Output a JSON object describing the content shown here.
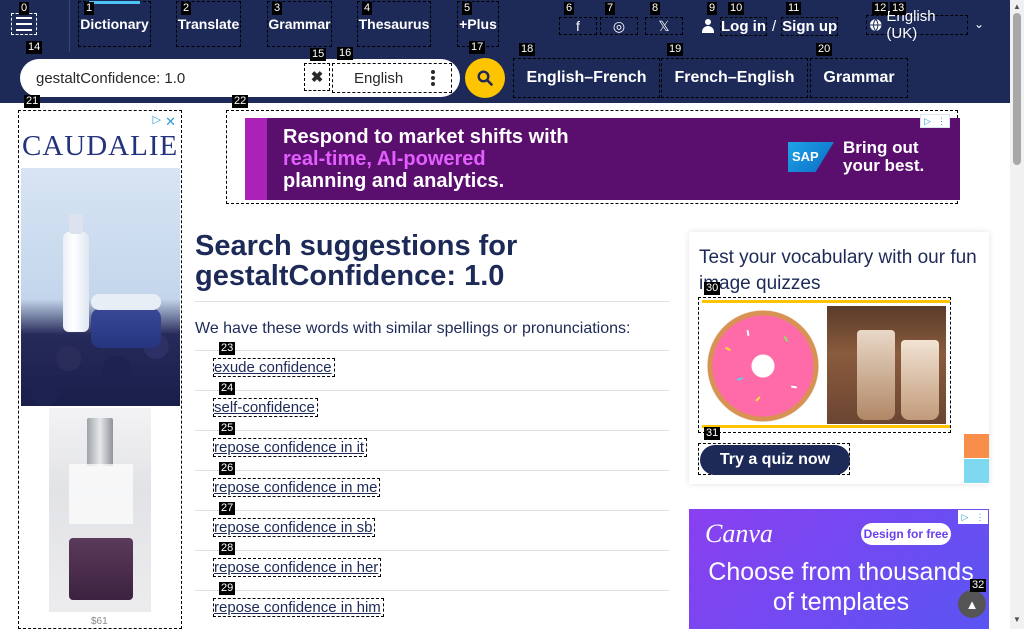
{
  "nav": {
    "items": [
      {
        "label": "Dictionary",
        "badge": "1"
      },
      {
        "label": "Translate",
        "badge": "2"
      },
      {
        "label": "Grammar",
        "badge": "3"
      },
      {
        "label": "Thesaurus",
        "badge": "4"
      },
      {
        "label": "+Plus",
        "badge": "5"
      }
    ],
    "menu_badge": "0",
    "social_icons": [
      "facebook-icon",
      "instagram-icon",
      "x-icon"
    ],
    "social_glyphs": {
      "facebook": "f",
      "instagram": "◎",
      "x": "𝕏"
    },
    "social_badges": [
      "6",
      "7",
      "8"
    ],
    "login": {
      "log_in": "Log in",
      "separator": "/",
      "sign_up": "Sign up",
      "badges": [
        "9",
        "10",
        "11"
      ]
    },
    "language": {
      "label": "English (UK)",
      "badges": [
        "12",
        "13"
      ]
    }
  },
  "search": {
    "value": "gestaltConfidence: 1.0",
    "dictionary": "English",
    "badges": {
      "input": "14",
      "clear": "15",
      "dictionary": "16",
      "button": "17"
    }
  },
  "quicklinks": [
    {
      "label": "English–French",
      "badge": "18"
    },
    {
      "label": "French–English",
      "badge": "19"
    },
    {
      "label": "Grammar",
      "badge": "20"
    }
  ],
  "ads": {
    "left": {
      "brand": "CAUDALIE",
      "price": "$61",
      "badge": "21"
    },
    "top": {
      "line1_prefix": "Respond to market shifts with",
      "line2_hl": "real-time, AI-powered",
      "line3": "planning and analytics.",
      "brand": "SAP",
      "slogan_line1": "Bring out",
      "slogan_line2": "your best.",
      "badge": "22"
    },
    "canva": {
      "brand": "Canva",
      "pill": "Design for free",
      "line1": "Choose from thousands",
      "line2": "of templates",
      "badge": "32"
    }
  },
  "main": {
    "title_prefix": "Search suggestions for",
    "query": "gestaltConfidence: 1.0",
    "subtitle": "We have these words with similar spellings or pronunciations:",
    "suggestions": [
      {
        "label": "exude confidence",
        "badge": "23"
      },
      {
        "label": "self-confidence",
        "badge": "24"
      },
      {
        "label": "repose confidence in it",
        "badge": "25"
      },
      {
        "label": "repose confidence in me",
        "badge": "26"
      },
      {
        "label": "repose confidence in sb",
        "badge": "27"
      },
      {
        "label": "repose confidence in her",
        "badge": "28"
      },
      {
        "label": "repose confidence in him",
        "badge": "29"
      }
    ]
  },
  "quiz": {
    "title": "Test your vocabulary with our fun image quizzes",
    "button": "Try a quiz now",
    "image_badge": "30",
    "button_badge": "31"
  },
  "colors": {
    "navy": "#1d2a57",
    "yellow": "#fec400",
    "link": "#1d2a57"
  }
}
